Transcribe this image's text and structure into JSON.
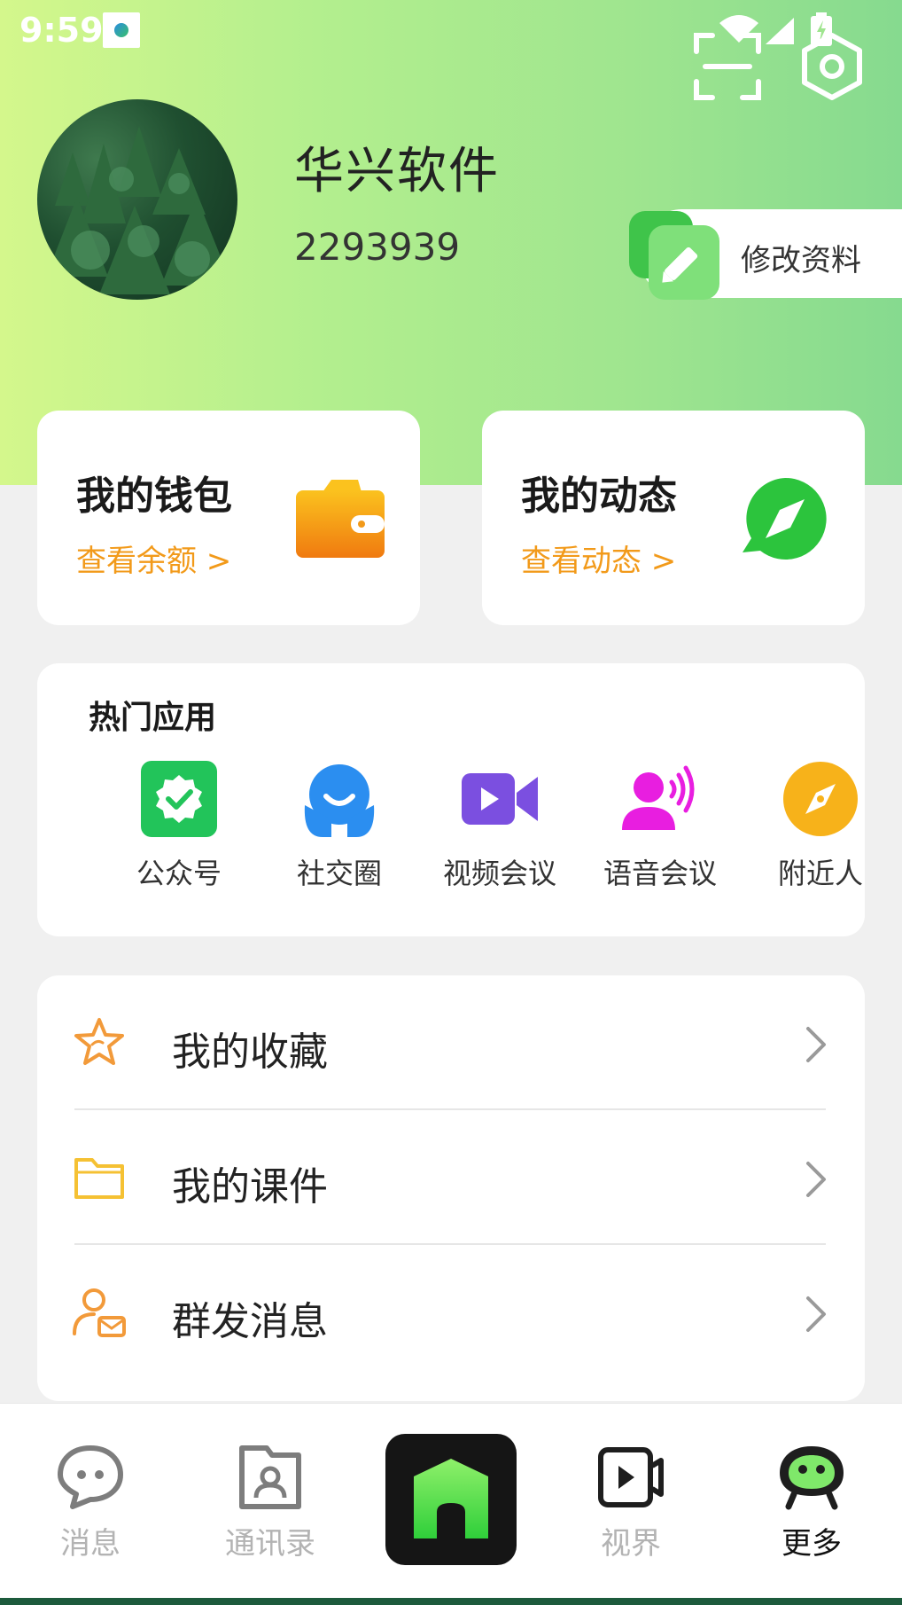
{
  "status_bar": {
    "time": "9:59"
  },
  "profile": {
    "name": "华兴软件",
    "id": "2293939",
    "edit_label": "修改资料"
  },
  "cards": {
    "wallet": {
      "title": "我的钱包",
      "subtitle": "查看余额 >"
    },
    "moments": {
      "title": "我的动态",
      "subtitle": "查看动态 >"
    }
  },
  "hot_apps": {
    "title": "热门应用",
    "items": [
      {
        "label": "公众号",
        "icon": "verified-badge-icon",
        "color": "#22c45a"
      },
      {
        "label": "社交圈",
        "icon": "social-person-icon",
        "color": "#2b8ef0"
      },
      {
        "label": "视频会议",
        "icon": "video-camera-icon",
        "color": "#7b4fe0"
      },
      {
        "label": "语音会议",
        "icon": "voice-person-icon",
        "color": "#e81ee0"
      },
      {
        "label": "附近人",
        "icon": "compass-icon",
        "color": "#f7b21a"
      }
    ]
  },
  "menu": [
    {
      "label": "我的收藏",
      "icon": "star-icon"
    },
    {
      "label": "我的课件",
      "icon": "folder-icon"
    },
    {
      "label": "群发消息",
      "icon": "person-mail-icon"
    }
  ],
  "bottom_nav": [
    {
      "label": "消息",
      "icon": "chat-bubble-icon"
    },
    {
      "label": "通讯录",
      "icon": "contacts-folder-icon"
    },
    {
      "label": "",
      "icon": "home-icon"
    },
    {
      "label": "视界",
      "icon": "video-play-icon"
    },
    {
      "label": "更多",
      "icon": "robot-face-icon",
      "active": true
    }
  ],
  "colors": {
    "accent_orange": "#f29a1a",
    "header_gradient_start": "#d4f78c",
    "header_gradient_end": "#86da8f"
  }
}
